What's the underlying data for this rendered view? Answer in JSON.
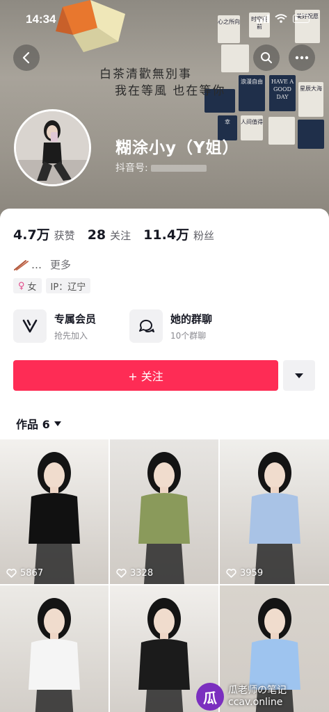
{
  "status_bar": {
    "time": "14:34"
  },
  "banner": {
    "wall_line_1": "白茶清歡無別事",
    "wall_line_2": "我在等風 也在等你",
    "cards": [
      "心之所向",
      "时空在前",
      "美好祝愿",
      "浪漫自由",
      "HAVE A GOOD DAY",
      "星辰大海",
      "幸",
      "人间值得"
    ]
  },
  "profile": {
    "nickname": "糊涂小y（Y姐）",
    "douyin_id_label": "抖音号:",
    "avatar_icon": "avatar-photo"
  },
  "stats": [
    {
      "value": "4.7万",
      "label": "获赞"
    },
    {
      "value": "28",
      "label": "关注"
    },
    {
      "value": "11.4万",
      "label": "粉丝"
    }
  ],
  "bio": {
    "text": "…",
    "more": "更多"
  },
  "tags": {
    "gender": "女",
    "ip": "IP：辽宁"
  },
  "features": [
    {
      "title": "专属会员",
      "subtitle": "抢先加入",
      "icon": "v-member-icon"
    },
    {
      "title": "她的群聊",
      "subtitle": "10个群聊",
      "icon": "chat-bubble-icon"
    }
  ],
  "follow_button": "+ 关注",
  "works_tab": {
    "label": "作品 6"
  },
  "videos": [
    {
      "likes": "5867",
      "top": "#f3f1ee",
      "outfit": "#111111"
    },
    {
      "likes": "3328",
      "top": "#e7e5e2",
      "outfit": "#8a9a5b"
    },
    {
      "likes": "3959",
      "top": "#f0efec",
      "outfit": "#a9c3e6"
    },
    {
      "likes": "",
      "top": "#eceae6",
      "outfit": "#f5f5f5"
    },
    {
      "likes": "",
      "top": "#f1efec",
      "outfit": "#1b1b1b"
    },
    {
      "likes": "",
      "top": "#d9d4cd",
      "outfit": "#9ec4ef"
    }
  ],
  "watermark": {
    "logo": "瓜",
    "line1": "瓜老师の笔记",
    "line2": "ccav.online"
  },
  "colors": {
    "accent": "#fe2c55"
  }
}
